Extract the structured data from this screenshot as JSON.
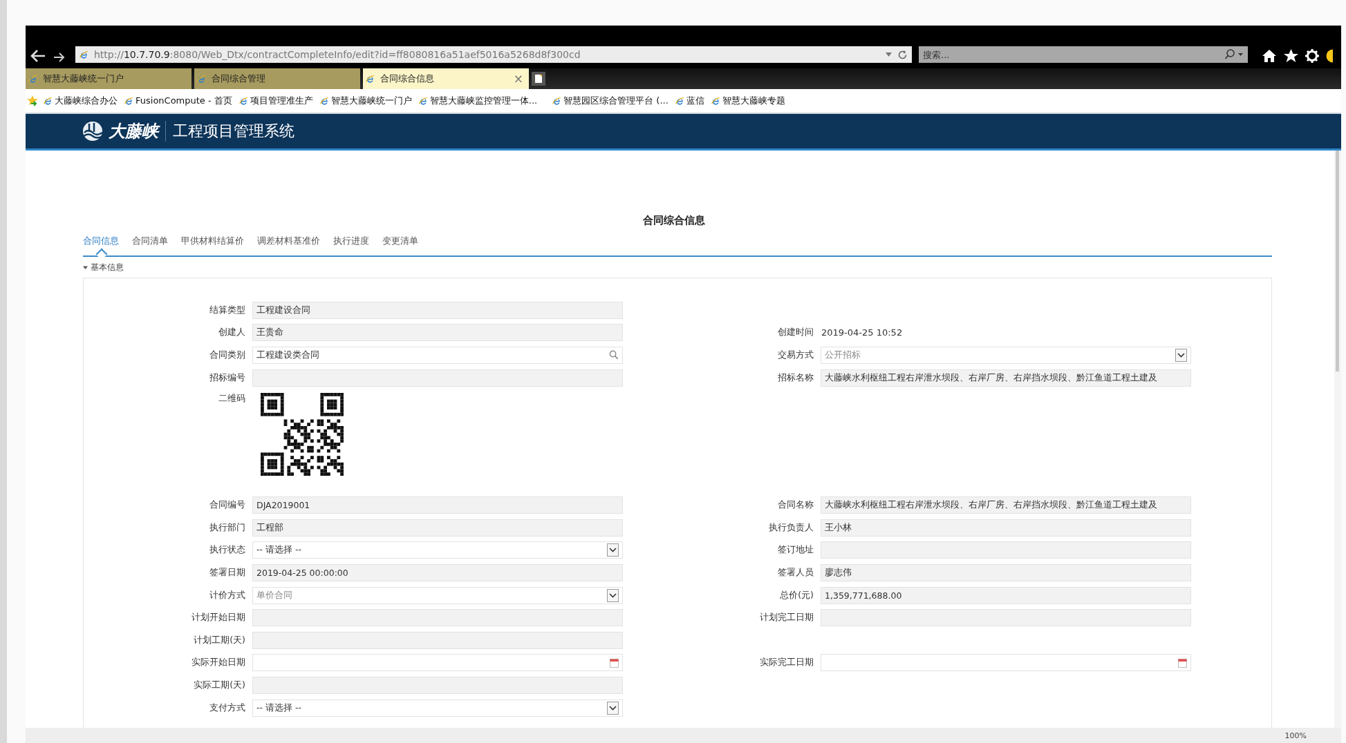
{
  "browser": {
    "address": "http://**10.7.70.9**:8080/Web_Dtx/contractCompleteInfo/edit?id=ff8080816a51aef5016a5268d8f300cd",
    "search_placeholder": "搜索...",
    "tabs": [
      {
        "label": "智慧大藤峡统一门户",
        "selected": false
      },
      {
        "label": "合同综合管理",
        "selected": false
      },
      {
        "label": "合同综合信息",
        "selected": true,
        "close": "×"
      }
    ],
    "bookmarks": [
      "大藤峡综合办公",
      "FusionCompute - 首页",
      "项目管理准生产",
      "智慧大藤峡统一门户",
      "智慧大藤峡监控管理一体...",
      "智慧园区综合管理平台 (...",
      "蓝信",
      "智慧大藤峡专题"
    ],
    "zoom": "100%"
  },
  "header": {
    "logo_text": "大藤峡",
    "title": "工程项目管理系统"
  },
  "page": {
    "title": "合同综合信息",
    "tabs": [
      {
        "label": "合同信息",
        "selected": true
      },
      {
        "label": "合同清单",
        "selected": false
      },
      {
        "label": "甲供材料结算价",
        "selected": false
      },
      {
        "label": "调差材料基准价",
        "selected": false
      },
      {
        "label": "执行进度",
        "selected": false
      },
      {
        "label": "变更清单",
        "selected": false
      }
    ],
    "section": {
      "title": "基本信息",
      "expanded": true
    }
  },
  "form": {
    "rows": [
      {
        "left": {
          "label": "结算类型",
          "kind": "readonly",
          "value": "工程建设合同"
        },
        "right": null
      },
      {
        "left": {
          "label": "创建人",
          "kind": "readonly",
          "value": "王贵命"
        },
        "right": {
          "label": "创建时间",
          "kind": "text",
          "value": "2019-04-25 10:52"
        }
      },
      {
        "left": {
          "label": "合同类别",
          "kind": "search",
          "value": "工程建设类合同"
        },
        "right": {
          "label": "交易方式",
          "kind": "select",
          "value": "公开招标",
          "disabled": true
        }
      },
      {
        "left": {
          "label": "招标编号",
          "kind": "readonly"
        },
        "right": {
          "label": "招标名称",
          "kind": "readonly",
          "value": "大藤峡水利枢纽工程右岸泄水坝段、右岸厂房、右岸挡水坝段、黔江鱼道工程土建及"
        }
      },
      {
        "left": {
          "label": "二维码",
          "kind": "qr"
        },
        "right": null
      },
      {
        "left": {
          "label": "合同编号",
          "kind": "readonly",
          "value": "DJA2019001"
        },
        "right": {
          "label": "合同名称",
          "kind": "readonly",
          "value": "大藤峡水利枢纽工程右岸泄水坝段、右岸厂房、右岸挡水坝段、黔江鱼道工程土建及"
        }
      },
      {
        "left": {
          "label": "执行部门",
          "kind": "readonly",
          "value": "工程部"
        },
        "right": {
          "label": "执行负责人",
          "kind": "readonly",
          "value": "王小林"
        }
      },
      {
        "left": {
          "label": "执行状态",
          "kind": "select",
          "value": "-- 请选择 --",
          "disabled": false
        },
        "right": {
          "label": "签订地址",
          "kind": "readonly"
        }
      },
      {
        "left": {
          "label": "签署日期",
          "kind": "readonly",
          "value": "2019-04-25 00:00:00"
        },
        "right": {
          "label": "签署人员",
          "kind": "readonly",
          "value": "廖志伟"
        }
      },
      {
        "left": {
          "label": "计价方式",
          "kind": "select",
          "value": "单价合同",
          "disabled": true
        },
        "right": {
          "label": "总价(元)",
          "kind": "readonly",
          "value": "1,359,771,688.00"
        }
      },
      {
        "left": {
          "label": "计划开始日期",
          "kind": "readonly"
        },
        "right": {
          "label": "计划完工日期",
          "kind": "readonly"
        }
      },
      {
        "left": {
          "label": "计划工期(天)",
          "kind": "readonly"
        },
        "right": null
      },
      {
        "left": {
          "label": "实际开始日期",
          "kind": "date"
        },
        "right": {
          "label": "实际完工日期",
          "kind": "date"
        }
      },
      {
        "left": {
          "label": "实际工期(天)",
          "kind": "readonly"
        },
        "right": null
      },
      {
        "left": {
          "label": "支付方式",
          "kind": "select",
          "value": "-- 请选择 --",
          "disabled": false
        },
        "right": null
      }
    ]
  }
}
